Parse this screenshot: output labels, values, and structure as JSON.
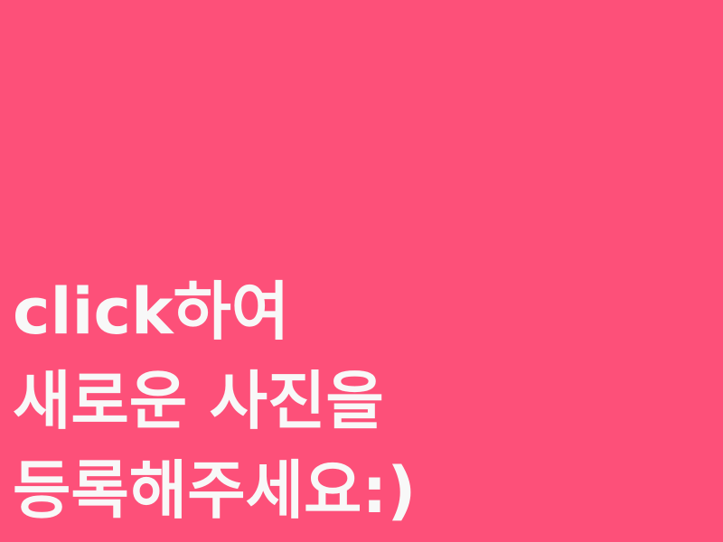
{
  "upload": {
    "background_color": "#fd5079",
    "text_color": "#f8f8f8",
    "lines": [
      "click하여",
      "새로운 사진을",
      "등록해주세요:)"
    ]
  }
}
